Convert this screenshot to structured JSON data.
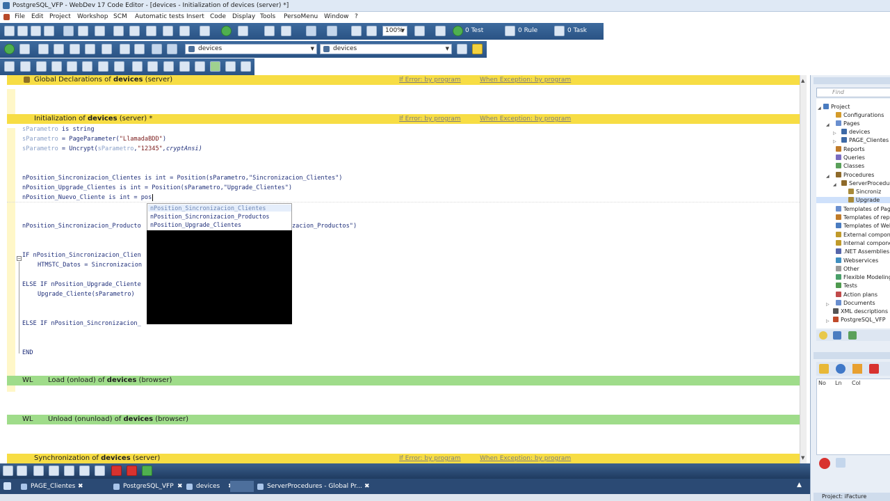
{
  "window": {
    "title": "PostgreSQL_VFP - WebDev 17  Code Editor - [devices - Initialization of devices (server) *]"
  },
  "menu": [
    "File",
    "Edit",
    "Project",
    "Workshop",
    "SCM",
    "Automatic tests",
    "Insert",
    "Code",
    "Display",
    "Tools",
    "PersoMenu",
    "Window",
    "?"
  ],
  "toolbar": {
    "zoom": "100%",
    "test_count": "0 Test",
    "rule_count": "0 Rule",
    "task_count": "0 Task",
    "combo1": "devices",
    "combo2": "devices"
  },
  "sections": {
    "global": {
      "prefix": "Global Declarations of ",
      "object": "devices",
      "suffix": " (server)"
    },
    "init": {
      "prefix": "Initialization of ",
      "object": "devices",
      "suffix": " (server) *"
    },
    "load": {
      "wl": "WL",
      "prefix": "Load (onload) of ",
      "object": "devices",
      "suffix": " (browser)"
    },
    "unload": {
      "wl": "WL",
      "prefix": "Unload (onunload) of ",
      "object": "devices",
      "suffix": " (browser)"
    },
    "sync": {
      "prefix": "Synchronization of ",
      "object": "devices",
      "suffix": " (server)"
    },
    "if_error": "If Error: by program",
    "when_exception": "When Exception: by program"
  },
  "code": [
    {
      "var": "sParametro",
      "rest": " is string"
    },
    {
      "var": "sParametro",
      "rest": " = PageParameter(",
      "str": "\"LlamadaBDD\"",
      "end": ")"
    },
    {
      "var": "sParametro",
      "rest": " = Uncrypt(",
      "var2": "sParametro",
      "rest2": ",",
      "str": "\"12345\"",
      "end": ",cryptAnsi)"
    },
    {
      "text": "nPosition_Sincronizacion_Clientes is int = Position(sParametro,\"Sincronizacion_Clientes\")"
    },
    {
      "text": "nPosition_Upgrade_Clientes is int = Position(sParametro,\"Upgrade_Clientes\")"
    },
    {
      "text": "nPosition_Nuevo_Cliente is int = pos"
    },
    {
      "text_a": "nPosition_Sincronizacion_Producto",
      "text_b": "zacion_Productos\")"
    },
    {
      "text": "IF nPosition_Sincronizacion_Clien"
    },
    {
      "text": "HTMSTC_Datos = Sincronizacion"
    },
    {
      "text": "ELSE IF nPosition_Upgrade_Cliente"
    },
    {
      "text": "Upgrade_Cliente(sParametro)"
    },
    {
      "text": "ELSE IF nPosition_Sincronizacion_"
    },
    {
      "text": "END"
    }
  ],
  "autocomplete": [
    "nPosition_Sincronizacion_Clientes",
    "nPosition_Sincronizacion_Productos",
    "nPosition_Upgrade_Clientes"
  ],
  "taskbar": [
    "PAGE_Clientes",
    "PostgreSQL_VFP",
    "devices",
    "ServerProcedures - Global Pr..."
  ],
  "project_explorer": {
    "find_placeholder": "Find",
    "tree": [
      {
        "label": "Project",
        "level": 0
      },
      {
        "label": "Configurations",
        "level": 1
      },
      {
        "label": "Pages",
        "level": 1
      },
      {
        "label": "devices",
        "level": 2
      },
      {
        "label": "PAGE_Clientes",
        "level": 2
      },
      {
        "label": "Reports",
        "level": 1
      },
      {
        "label": "Queries",
        "level": 1
      },
      {
        "label": "Classes",
        "level": 1
      },
      {
        "label": "Procedures",
        "level": 1
      },
      {
        "label": "ServerProcedures",
        "level": 2
      },
      {
        "label": "Sincroniz",
        "level": 3
      },
      {
        "label": "Upgrade",
        "level": 3
      },
      {
        "label": "Templates of Pages",
        "level": 1
      },
      {
        "label": "Templates of reports",
        "level": 1
      },
      {
        "label": "Templates of Webservices",
        "level": 1
      },
      {
        "label": "External components",
        "level": 1
      },
      {
        "label": "Internal components",
        "level": 1
      },
      {
        "label": ".NET Assemblies",
        "level": 1
      },
      {
        "label": "Webservices",
        "level": 1
      },
      {
        "label": "Other",
        "level": 1
      },
      {
        "label": "Flexible Modeling",
        "level": 1
      },
      {
        "label": "Tests",
        "level": 1
      },
      {
        "label": "Action plans",
        "level": 1
      },
      {
        "label": "Documents",
        "level": 1
      },
      {
        "label": "XML descriptions",
        "level": 1
      },
      {
        "label": "PostgreSQL_VFP",
        "level": 1
      }
    ],
    "grid_headers": [
      "No",
      "Ln",
      "Col"
    ],
    "footer": "Project: iFacture"
  }
}
